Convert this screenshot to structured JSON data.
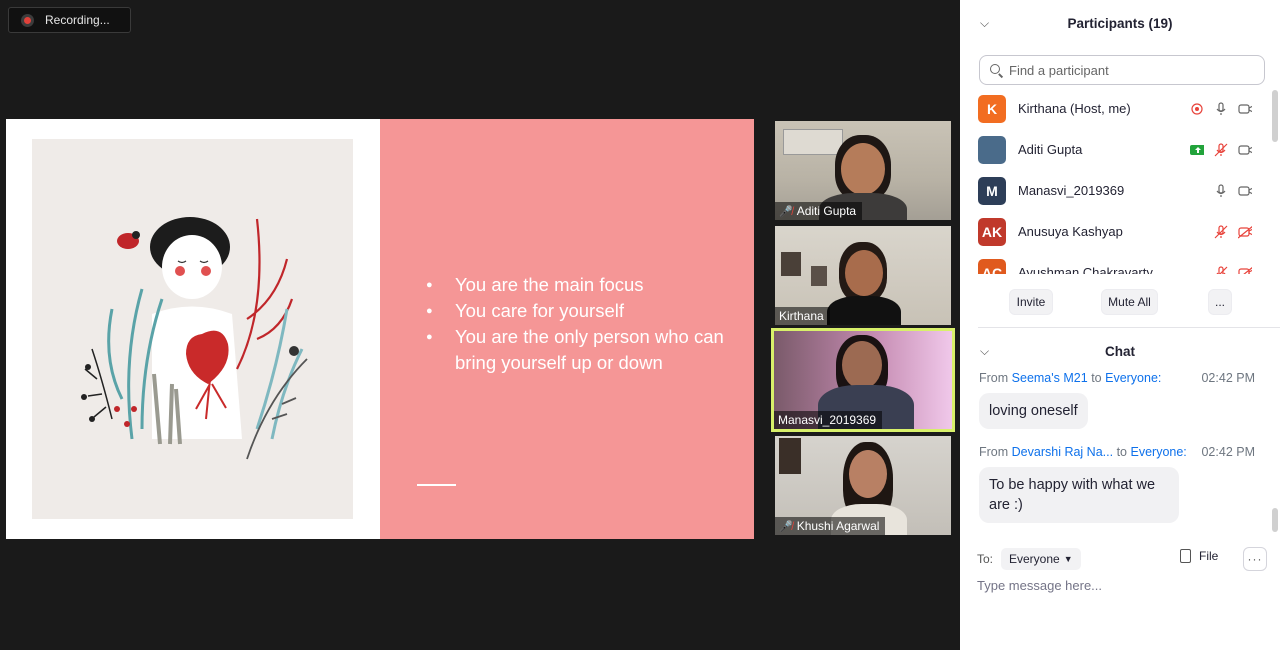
{
  "recording": {
    "label": "Recording..."
  },
  "slide": {
    "bullets": [
      "You  are the main focus",
      "You care for yourself",
      "You are the only person who can bring yourself up or down"
    ]
  },
  "videos": [
    {
      "name": "Aditi Gupta",
      "muted": true
    },
    {
      "name": "Kirthana",
      "muted": false
    },
    {
      "name": "Manasvi_2019369",
      "muted": false,
      "active": true
    },
    {
      "name": "Khushi Agarwal",
      "muted": true
    }
  ],
  "participants": {
    "title": "Participants (19)",
    "search_placeholder": "Find a participant",
    "list": [
      {
        "initials": "K",
        "name": "Kirthana (Host, me)",
        "color": "#f26d21"
      },
      {
        "initials": "",
        "name": "Aditi Gupta",
        "color": "#4a6b8a"
      },
      {
        "initials": "M",
        "name": "Manasvi_2019369",
        "color": "#2d3e58"
      },
      {
        "initials": "AK",
        "name": "Anusuya Kashyap",
        "color": "#c0392b"
      },
      {
        "initials": "AC",
        "name": "Ayushman Chakravarty",
        "color": "#e05a1e"
      }
    ],
    "buttons": {
      "invite": "Invite",
      "mute_all": "Mute All",
      "more": "..."
    }
  },
  "chat": {
    "title": "Chat",
    "messages": [
      {
        "from_label": "From",
        "sender": "Seema's M21",
        "to_label": "to",
        "recipient": "Everyone:",
        "time": "02:42 PM",
        "text": "loving oneself"
      },
      {
        "from_label": "From",
        "sender": "Devarshi Raj Na...",
        "to_label": "to",
        "recipient": "Everyone:",
        "time": "02:42 PM",
        "text": "To be happy with what we are :)"
      }
    ],
    "to_label": "To:",
    "to_value": "Everyone",
    "file_label": "File",
    "more_label": "···",
    "input_placeholder": "Type message here..."
  },
  "colors": {
    "slide_accent": "#f59696",
    "active_speaker_border": "#d8f06a",
    "link_blue": "#0e71eb",
    "muted_red": "#e8433b"
  }
}
